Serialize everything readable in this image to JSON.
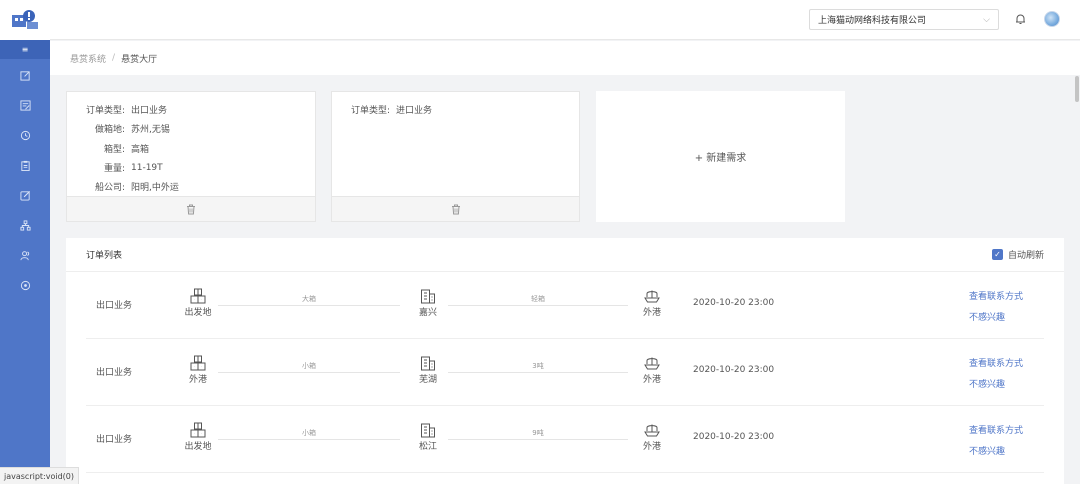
{
  "sidebar": {
    "collapse_label": "≡",
    "icons": [
      "edit-icon",
      "file-edit-icon",
      "history-icon",
      "clipboard-icon",
      "edit-square-icon",
      "network-icon",
      "users-icon",
      "compass-icon"
    ]
  },
  "header": {
    "company": "上海猫动网络科技有限公司"
  },
  "breadcrumb": {
    "items": [
      "悬赏系统",
      "悬赏大厅"
    ]
  },
  "cards": [
    {
      "fields": [
        {
          "k": "订单类型:",
          "v": "出口业务"
        },
        {
          "k": "做箱地:",
          "v": "苏州,无锡"
        },
        {
          "k": "箱型:",
          "v": "高箱"
        },
        {
          "k": "重量:",
          "v": "11-19T"
        },
        {
          "k": "船公司:",
          "v": "阳明,中外运"
        }
      ]
    },
    {
      "fields": [
        {
          "k": "订单类型:",
          "v": "进口业务"
        }
      ]
    }
  ],
  "new_card_label": "+ 新建需求",
  "orders": {
    "title": "订单列表",
    "auto_refresh_label": "自动刷新",
    "auto_refresh_checked": true,
    "rows": [
      {
        "type": "出口业务",
        "from": "出发地",
        "seg1": "大箱",
        "mid": "嘉兴",
        "seg2": "轻箱",
        "to": "外港",
        "time": "2020-10-20 23:00",
        "contact": "查看联系方式",
        "ignore": "不感兴趣"
      },
      {
        "type": "出口业务",
        "from": "外港",
        "seg1": "小箱",
        "mid": "芜湖",
        "seg2": "3吨",
        "to": "外港",
        "time": "2020-10-20 23:00",
        "contact": "查看联系方式",
        "ignore": "不感兴趣"
      },
      {
        "type": "出口业务",
        "from": "出发地",
        "seg1": "小箱",
        "mid": "松江",
        "seg2": "9吨",
        "to": "外港",
        "time": "2020-10-20 23:00",
        "contact": "查看联系方式",
        "ignore": "不感兴趣"
      }
    ]
  },
  "status_bar": "javascript:void(0)",
  "colors": {
    "accent": "#4f76c8",
    "sidebar": "#4f76c8"
  }
}
